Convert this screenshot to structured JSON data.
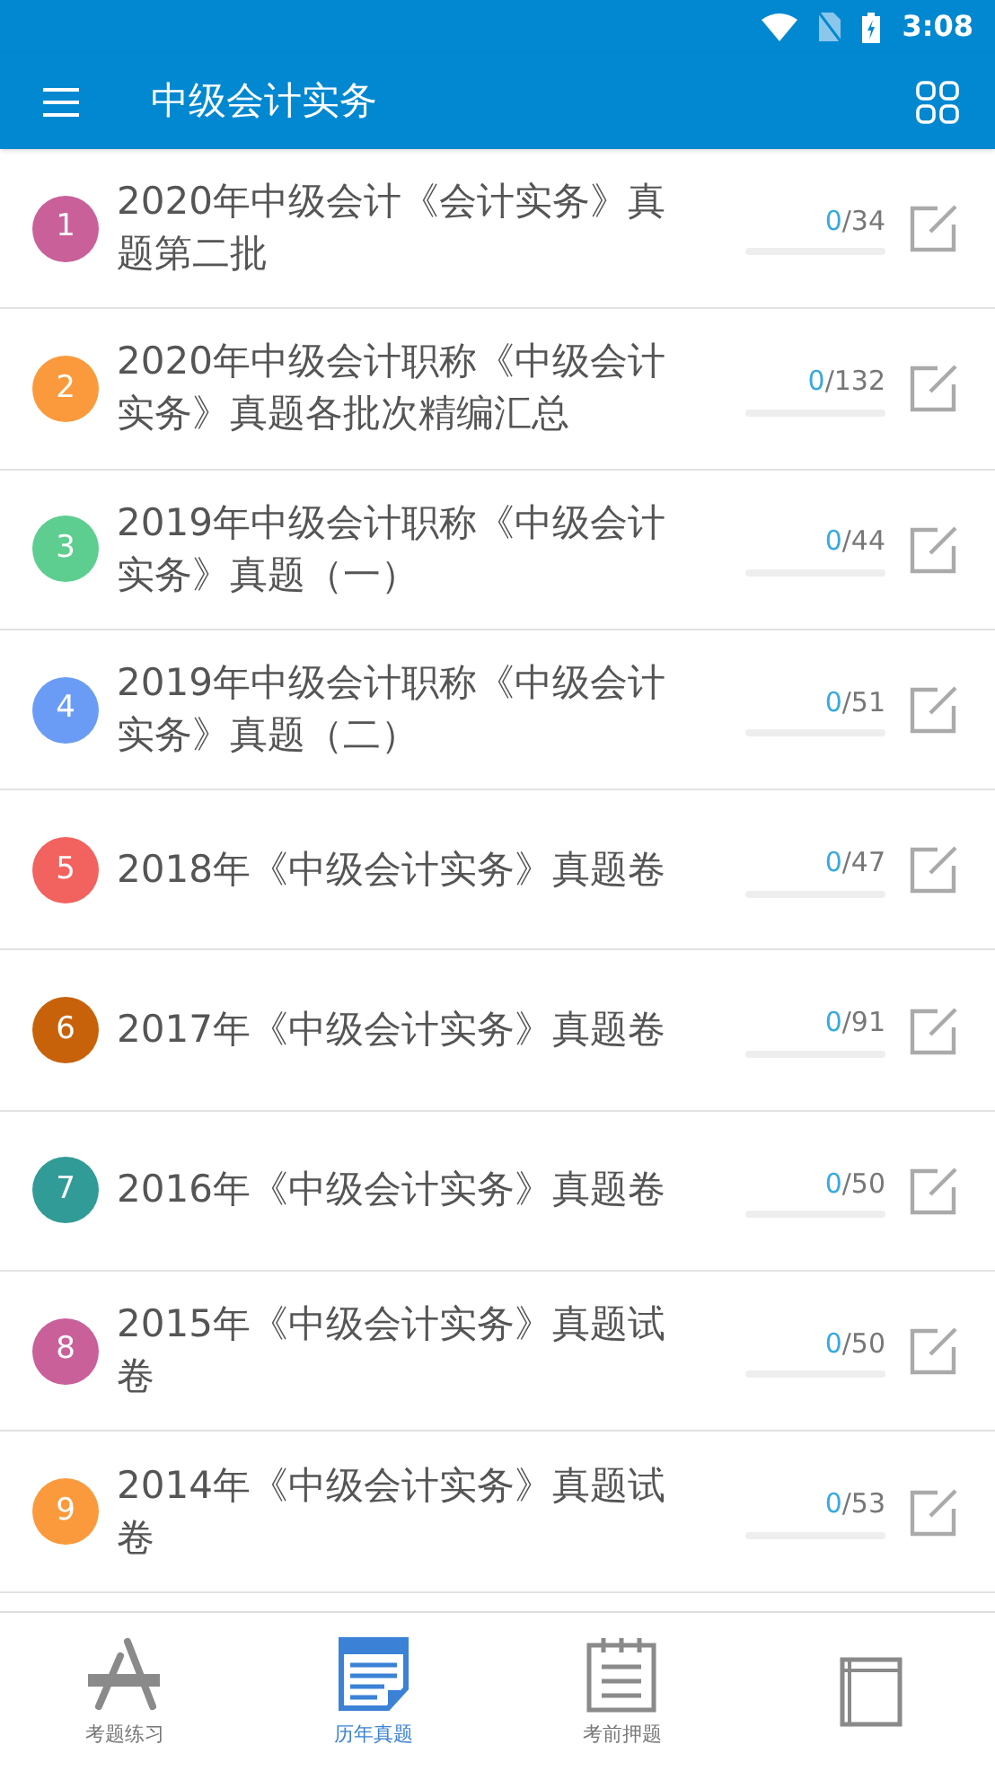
{
  "status_bar": {
    "time": "3:08"
  },
  "app_bar": {
    "title": "中级会计实务"
  },
  "papers": [
    {
      "number": "1",
      "color": "#c9609a",
      "title": "2020年中级会计《会计实务》真题第二批",
      "done": "0",
      "total": "/34",
      "level": 0
    },
    {
      "number": "2",
      "color": "#fb9a3c",
      "title": "2020年中级会计职称《中级会计实务》真题各批次精编汇总",
      "done": "0",
      "total": "/132",
      "level": 0
    },
    {
      "number": "3",
      "color": "#5dce8f",
      "title": "2019年中级会计职称《中级会计实务》真题（一）",
      "done": "0",
      "total": "/44",
      "level": 0
    },
    {
      "number": "4",
      "color": "#6b9cf5",
      "title": "2019年中级会计职称《中级会计实务》真题（二）",
      "done": "0",
      "total": "/51",
      "level": 0
    },
    {
      "number": "5",
      "color": "#f2625e",
      "title": "2018年《中级会计实务》真题卷",
      "done": "0",
      "total": "/47",
      "level": 0
    },
    {
      "number": "6",
      "color": "#c8620a",
      "title": "2017年《中级会计实务》真题卷",
      "done": "0",
      "total": "/91",
      "level": 0
    },
    {
      "number": "7",
      "color": "#319b97",
      "title": "2016年《中级会计实务》真题卷",
      "done": "0",
      "total": "/50",
      "level": 0
    },
    {
      "number": "8",
      "color": "#c9609a",
      "title": "2015年《中级会计实务》真题试卷",
      "done": "0",
      "total": "/50",
      "level": 0
    },
    {
      "number": "9",
      "color": "#fb9a3c",
      "title": "2014年《中级会计实务》真题试卷",
      "done": "0",
      "total": "/53",
      "level": 0
    }
  ],
  "bottom_nav": [
    {
      "kind": "practice",
      "label": "考题练习",
      "selected": false
    },
    {
      "kind": "papers",
      "label": "历年真题",
      "selected": true
    },
    {
      "kind": "forecast",
      "label": "考前押题",
      "selected": false
    },
    {
      "kind": "book",
      "selected": false
    }
  ]
}
